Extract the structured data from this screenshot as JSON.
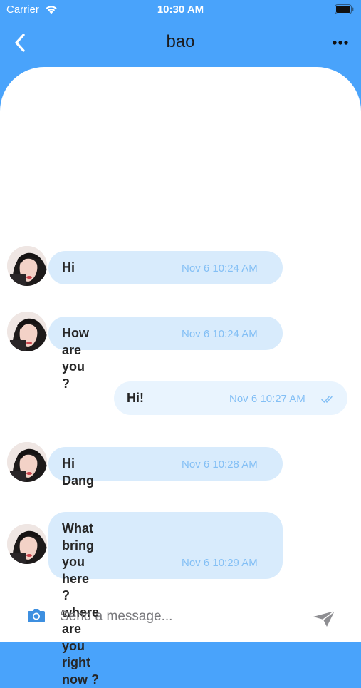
{
  "status_bar": {
    "carrier": "Carrier",
    "time": "10:30 AM"
  },
  "header": {
    "title": "bao"
  },
  "messages": [
    {
      "direction": "incoming",
      "text": "Hi",
      "time": "Nov 6 10:24 AM"
    },
    {
      "direction": "incoming",
      "text": "How are you ?",
      "time": "Nov 6 10:24 AM"
    },
    {
      "direction": "outgoing",
      "text": "Hi!",
      "time": "Nov 6 10:27 AM",
      "read": true
    },
    {
      "direction": "incoming",
      "text": "Hi Dang",
      "time": "Nov 6 10:28 AM"
    },
    {
      "direction": "incoming",
      "text": "What bring you\nhere ? where are\nyou right now ?",
      "time": "Nov 6 10:29 AM"
    }
  ],
  "composer": {
    "placeholder": "Send a message..."
  },
  "colors": {
    "header_background": "#49a3fb",
    "incoming_bubble": "#d8ebfc",
    "outgoing_bubble": "#e9f4fe",
    "timestamp": "#83bff5",
    "camera_icon": "#3d8fe0"
  },
  "icons": [
    "back-icon",
    "more-icon",
    "camera-icon",
    "send-icon",
    "wifi-icon",
    "battery-icon",
    "double-check-icon"
  ]
}
